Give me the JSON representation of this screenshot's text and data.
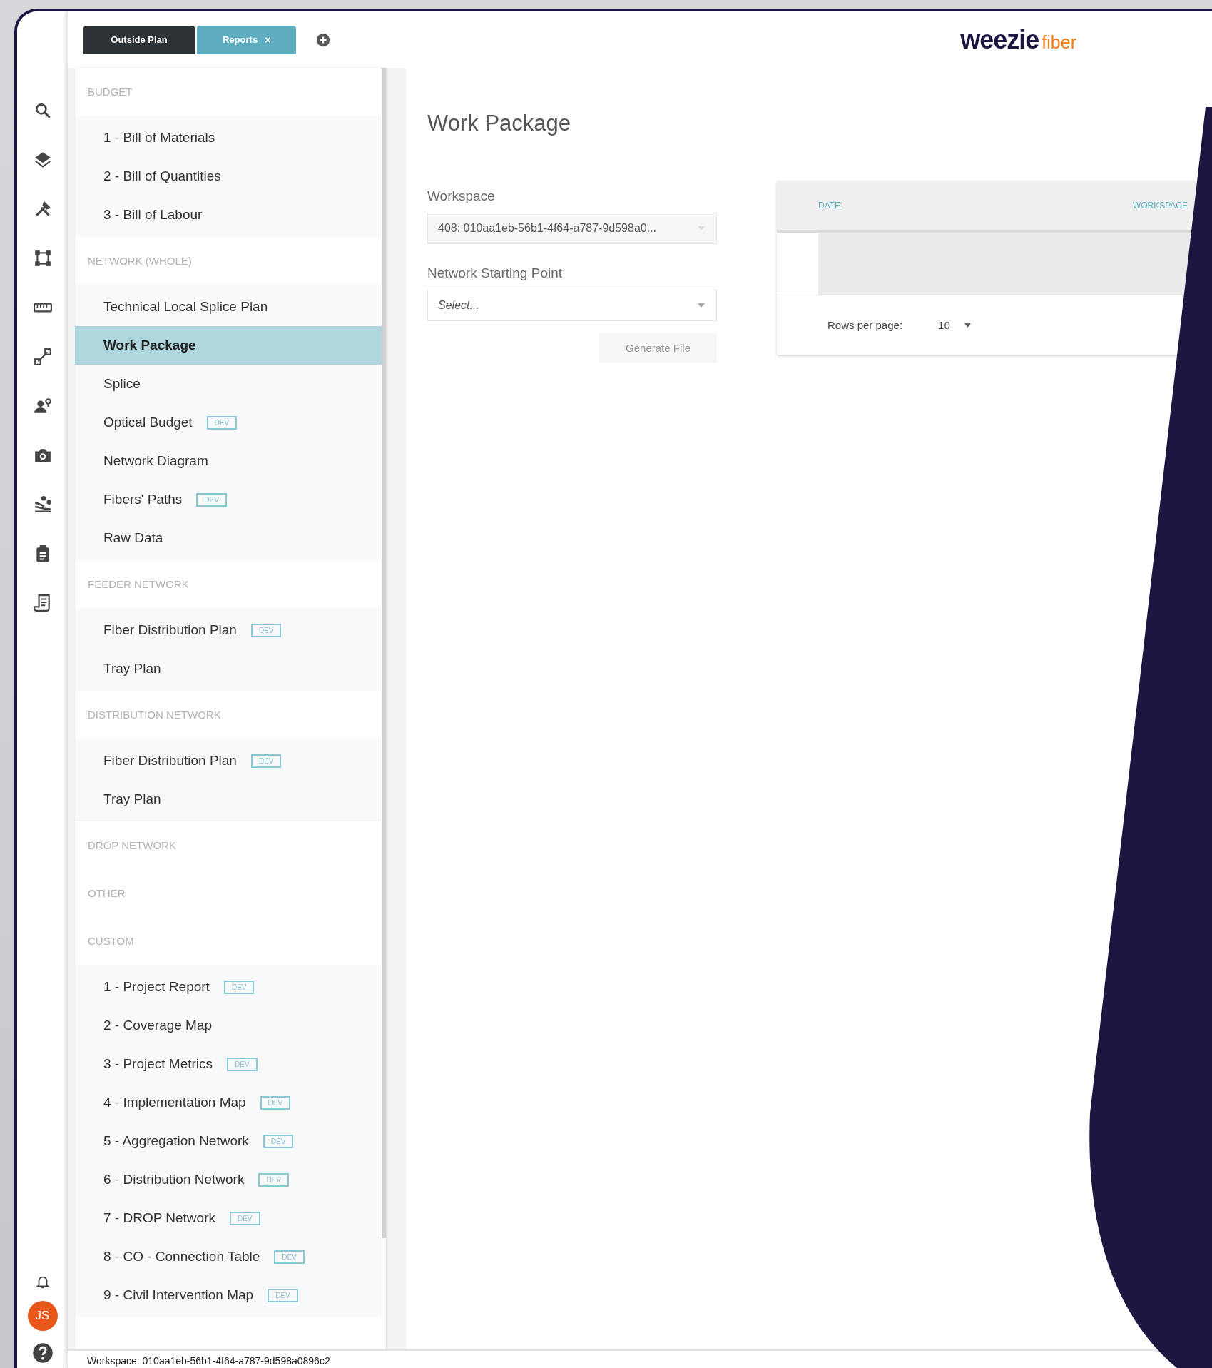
{
  "tabs": [
    {
      "label": "Outside Plan",
      "selected": false
    },
    {
      "label": "Reports",
      "selected": true,
      "close_icon": "×"
    }
  ],
  "logo": {
    "wordmark": "weezie",
    "suffix": "fiber"
  },
  "menu": {
    "sections": [
      {
        "title": "BUDGET",
        "items": [
          {
            "label": "1 - Bill of Materials",
            "selected": false
          },
          {
            "label": "2 - Bill of Quantities",
            "selected": false
          },
          {
            "label": "3 - Bill of Labour",
            "selected": false
          }
        ]
      },
      {
        "title": "NETWORK (WHOLE)",
        "items": [
          {
            "label": "Technical Local Splice Plan",
            "selected": false
          },
          {
            "label": "Work Package",
            "selected": true
          },
          {
            "label": "Splice",
            "selected": false
          },
          {
            "label": "Optical Budget",
            "selected": false,
            "badge": "DEV"
          },
          {
            "label": "Network Diagram",
            "selected": false
          },
          {
            "label": "Fibers' Paths",
            "selected": false,
            "badge": "DEV"
          },
          {
            "label": "Raw Data",
            "selected": false
          }
        ]
      },
      {
        "title": "FEEDER NETWORK",
        "items": [
          {
            "label": "Fiber Distribution Plan",
            "selected": false,
            "badge": "DEV"
          },
          {
            "label": "Tray Plan",
            "selected": false
          }
        ]
      },
      {
        "title": "DISTRIBUTION NETWORK",
        "items": [
          {
            "label": "Fiber Distribution Plan",
            "selected": false,
            "badge": "DEV"
          },
          {
            "label": "Tray Plan",
            "selected": false
          }
        ]
      },
      {
        "title": "DROP NETWORK"
      },
      {
        "title": "OTHER"
      },
      {
        "title": "CUSTOM",
        "items": [
          {
            "label": "1 - Project Report",
            "selected": false,
            "badge": "DEV"
          },
          {
            "label": "2 - Coverage Map",
            "selected": false
          },
          {
            "label": "3 - Project Metrics",
            "selected": false,
            "badge": "DEV"
          },
          {
            "label": "4 - Implementation Map",
            "selected": false,
            "badge": "DEV"
          },
          {
            "label": "5 - Aggregation Network",
            "selected": false,
            "badge": "DEV"
          },
          {
            "label": "6 - Distribution Network",
            "selected": false,
            "badge": "DEV"
          },
          {
            "label": "7 - DROP Network",
            "selected": false,
            "badge": "DEV"
          },
          {
            "label": "8 - CO - Connection Table",
            "selected": false,
            "badge": "DEV"
          },
          {
            "label": "9 - Civil Intervention Map",
            "selected": false,
            "badge": "DEV"
          }
        ]
      }
    ]
  },
  "page": {
    "title": "Work Package",
    "fields": [
      {
        "label": "Workspace",
        "value": "408: 010aa1eb-56b1-4f64-a787-9d598a0..."
      },
      {
        "label": "Network Starting Point",
        "placeholder": "Select..."
      }
    ],
    "button": {
      "label": "Generate File",
      "disabled": true
    }
  },
  "table": {
    "columns": [
      "DATE",
      "WORKSPACE"
    ],
    "rows_per_page_label": "Rows per page:",
    "rows_per_page": "10"
  },
  "user": {
    "initials": "JS"
  },
  "status_bar": {
    "text": "Workspace: 010aa1eb-56b1-4f64-a787-9d598a0896c2"
  }
}
